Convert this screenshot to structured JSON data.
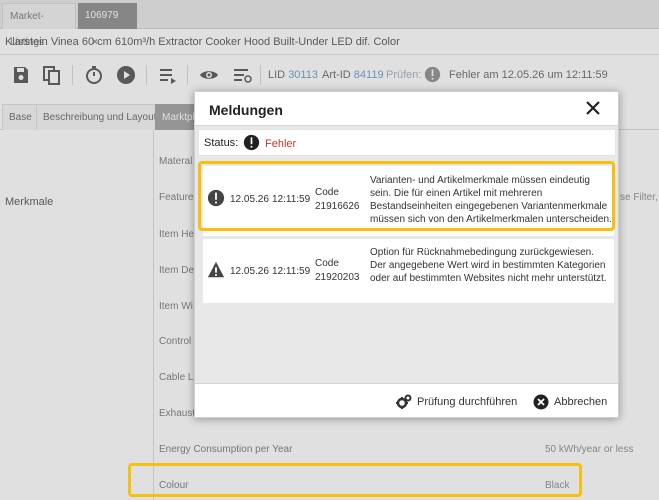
{
  "top_tabs": [
    {
      "label": "Market-Listings"
    },
    {
      "label": "106979"
    }
  ],
  "product_title": "Klarstein Vinea 60 cm 610m³/h Extractor Cooker Hood Built-Under LED dif. Color",
  "toolbar": {
    "lid_label": "LID",
    "lid_value": "30113",
    "artid_label": "Art-ID",
    "artid_value": "84119",
    "check_label": "Prüfen:",
    "check_status": "Fehler am 12.05.26 um 12:11:59"
  },
  "content_tabs": [
    "Base",
    "Beschreibung und Layout",
    "Marktpla"
  ],
  "section_label": "Merkmale",
  "fields": [
    {
      "label": "Materal"
    },
    {
      "label": "Features",
      "value": "se Filter, L"
    },
    {
      "label": "Item He"
    },
    {
      "label": "Item De"
    },
    {
      "label": "Item Wi"
    },
    {
      "label": "Control"
    },
    {
      "label": "Cable Le"
    },
    {
      "label": "Exhaust"
    },
    {
      "label": "Energy Consumption per Year",
      "value": "50 kWh/year or less"
    },
    {
      "label": "Colour",
      "value": "Black"
    }
  ],
  "modal": {
    "title": "Meldungen",
    "status_label": "Status:",
    "status_value": "Fehler",
    "messages": [
      {
        "icon": "error-circle-icon",
        "date": "12.05.26",
        "time": "12:11:59",
        "code_label": "Code",
        "code": "21916626",
        "text": "Varianten- und Artikelmerkmale müssen eindeutig sein. Die für einen Artikel mit mehreren Bestandseinheiten eingegebenen Variantenmerkmale müssen sich von den Artikelmerkmalen unterscheiden."
      },
      {
        "icon": "warning-triangle-icon",
        "date": "12.05.26",
        "time": "12:11:59",
        "code_label": "Code",
        "code": "21920203",
        "text": "Option für Rücknahmebedingung zurückgewiesen. Der angegebene Wert wird in bestimmten Kategorien oder auf bestimmten Websites nicht mehr unterstützt."
      }
    ],
    "run_check_label": "Prüfung durchführen",
    "cancel_label": "Abbrechen"
  },
  "colors": {
    "highlight": "#f5c10e",
    "error": "#c0392b",
    "id_link": "#7ca6cf"
  }
}
